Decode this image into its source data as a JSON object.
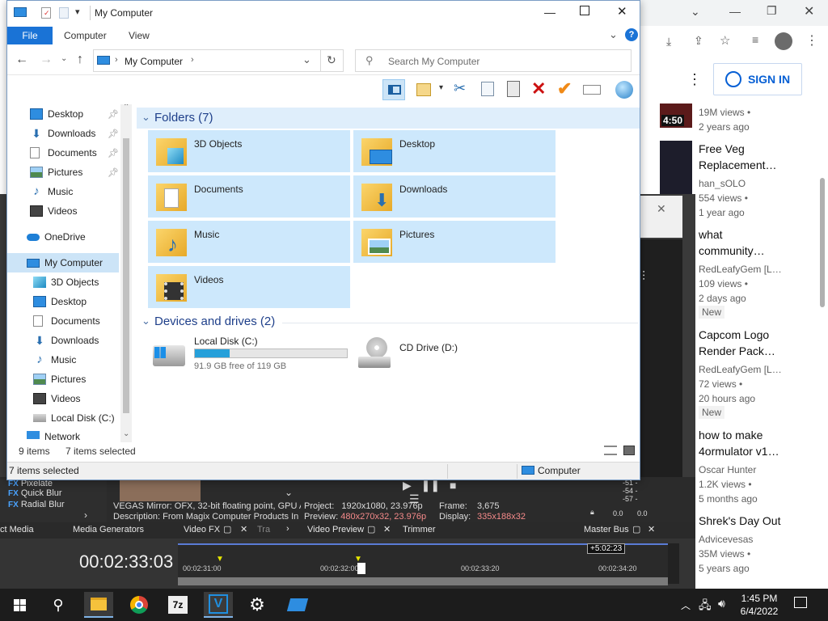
{
  "explorer": {
    "title": "My Computer",
    "menu": {
      "file": "File",
      "computer": "Computer",
      "view": "View"
    },
    "address": "My Computer",
    "search_placeholder": "Search My Computer",
    "nav": [
      {
        "label": "Desktop",
        "icon": "desktop-icon",
        "pinned": true
      },
      {
        "label": "Downloads",
        "icon": "download-icon",
        "pinned": true
      },
      {
        "label": "Documents",
        "icon": "document-icon",
        "pinned": true
      },
      {
        "label": "Pictures",
        "icon": "picture-icon",
        "pinned": true
      },
      {
        "label": "Music",
        "icon": "music-icon",
        "pinned": false
      },
      {
        "label": "Videos",
        "icon": "video-icon",
        "pinned": false
      },
      {
        "label": "OneDrive",
        "icon": "cloud-icon",
        "pinned": false
      },
      {
        "label": "My Computer",
        "icon": "computer-icon",
        "pinned": false
      },
      {
        "label": "3D Objects",
        "icon": "cube-icon",
        "pinned": false
      },
      {
        "label": "Desktop",
        "icon": "desktop-icon",
        "pinned": false
      },
      {
        "label": "Documents",
        "icon": "document-icon",
        "pinned": false
      },
      {
        "label": "Downloads",
        "icon": "download-icon",
        "pinned": false
      },
      {
        "label": "Music",
        "icon": "music-icon",
        "pinned": false
      },
      {
        "label": "Pictures",
        "icon": "picture-icon",
        "pinned": false
      },
      {
        "label": "Videos",
        "icon": "video-icon",
        "pinned": false
      },
      {
        "label": "Local Disk (C:)",
        "icon": "disk-icon",
        "pinned": false
      },
      {
        "label": "Network",
        "icon": "network-icon",
        "pinned": false
      }
    ],
    "folders_header": "Folders (7)",
    "folders": [
      "3D Objects",
      "Desktop",
      "Documents",
      "Downloads",
      "Music",
      "Pictures",
      "Videos"
    ],
    "drives_header": "Devices and drives (2)",
    "drive_c": {
      "name": "Local Disk (C:)",
      "free": "91.9 GB free of 119 GB",
      "used_fraction": 0.23
    },
    "drive_d": {
      "name": "CD Drive (D:)"
    },
    "status_items": "9 items",
    "status_selected": "7 items selected",
    "details_selected": "7 items selected",
    "details_location": "Computer"
  },
  "youtube": {
    "sign_in": "SIGN IN",
    "videos": [
      {
        "title": "",
        "channel": "",
        "views": "19M views •",
        "age": "2 years ago",
        "duration": "4:50",
        "new": false
      },
      {
        "title": "Free Veg Replacement…",
        "channel": "han_sOLO",
        "views": "554 views •",
        "age": "1 year ago",
        "new": false
      },
      {
        "title": "what community…",
        "channel": "RedLeafyGem [L…",
        "views": "109 views •",
        "age": "2 days ago",
        "new": true
      },
      {
        "title": "Capcom Logo Render Pack…",
        "channel": "RedLeafyGem [L…",
        "views": "72 views •",
        "age": "20 hours ago",
        "new": true
      },
      {
        "title": "how to make 4ormulator v1…",
        "channel": "Oscar Hunter",
        "views": "1.2K views •",
        "age": "5 months ago",
        "new": false
      },
      {
        "title": "Shrek's Day Out",
        "channel": "Advicevesas",
        "views": "35M views •",
        "age": "5 years ago",
        "new": false
      }
    ],
    "new_label": "New"
  },
  "vegas": {
    "fx_items": [
      "Pixelate",
      "Quick Blur",
      "Radial Blur"
    ],
    "mirror_line1": "VEGAS Mirror: OFX, 32-bit floating point, GPU A",
    "mirror_line2": "Description: From Magix Computer Products In",
    "project_label": "Project:",
    "project_value": "1920x1080, 23.976p",
    "preview_label": "Preview:",
    "preview_value": "480x270x32, 23.976p",
    "frame_label": "Frame:",
    "frame_value": "3,675",
    "display_label": "Display:",
    "display_value": "335x188x32",
    "tabs": [
      "ct Media",
      "Media Generators",
      "Video FX",
      "Tra",
      "Video Preview",
      "Trimmer",
      "Master Bus"
    ],
    "timecode": "00:02:33:03",
    "ruler": [
      "00:02:31:00",
      "00:02:32:00",
      "00:02:33:20",
      "00:02:34:20"
    ],
    "offset": "+5:02:23",
    "meter": [
      "-51 -",
      "-54 -",
      "-57 -"
    ],
    "meter_foot": [
      "0.0",
      "0.0"
    ]
  },
  "taskbar": {
    "time": "1:45 PM",
    "date": "6/4/2022"
  }
}
